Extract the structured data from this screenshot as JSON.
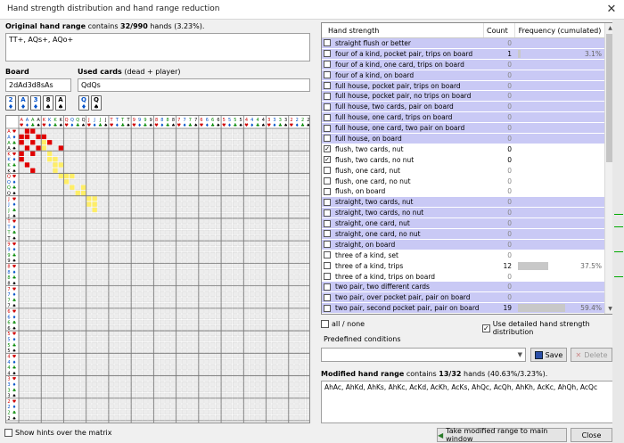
{
  "window": {
    "title": "Hand strength distribution and hand range reduction",
    "close_glyph": "✕"
  },
  "original_range": {
    "label": "Original hand range",
    "summary_prefix": "contains",
    "summary_count": "32/990",
    "summary_suffix": "hands (3.23%).",
    "value": "TT+, AQs+, AQo+"
  },
  "board": {
    "label": "Board",
    "value": "2dAd3d8sAs",
    "cards": [
      {
        "rank": "2",
        "suit": "♦",
        "color": "blu"
      },
      {
        "rank": "A",
        "suit": "♦",
        "color": "blu"
      },
      {
        "rank": "3",
        "suit": "♦",
        "color": "blu"
      },
      {
        "rank": "8",
        "suit": "♠",
        "color": "blk"
      },
      {
        "rank": "A",
        "suit": "♠",
        "color": "blk"
      }
    ]
  },
  "used_cards": {
    "label": "Used cards",
    "sublabel": "(dead + player)",
    "value": "QdQs",
    "cards": [
      {
        "rank": "Q",
        "suit": "♦",
        "color": "blu"
      },
      {
        "rank": "Q",
        "suit": "♠",
        "color": "blk"
      }
    ]
  },
  "matrix": {
    "ranks": [
      "A",
      "K",
      "Q",
      "J",
      "T",
      "9",
      "8",
      "7",
      "6",
      "5",
      "4",
      "3",
      "2"
    ],
    "suits": [
      {
        "glyph": "♥",
        "color": "#d00000"
      },
      {
        "glyph": "♦",
        "color": "#0050c8"
      },
      {
        "glyph": "♣",
        "color": "#008800"
      },
      {
        "glyph": "♠",
        "color": "#000000"
      }
    ],
    "red_cells": [
      [
        0,
        1
      ],
      [
        1,
        0
      ],
      [
        1,
        1
      ],
      [
        0,
        2
      ],
      [
        1,
        3
      ],
      [
        2,
        0
      ],
      [
        2,
        2
      ],
      [
        3,
        3
      ],
      [
        4,
        0
      ],
      [
        3,
        1
      ],
      [
        1,
        4
      ],
      [
        5,
        0
      ],
      [
        4,
        2
      ],
      [
        2,
        5
      ],
      [
        6,
        1
      ],
      [
        7,
        2
      ],
      [
        3,
        7
      ]
    ],
    "yellow_cells": [
      [
        2,
        4
      ],
      [
        3,
        4
      ],
      [
        4,
        5
      ],
      [
        5,
        5
      ],
      [
        5,
        6
      ],
      [
        6,
        6
      ],
      [
        6,
        7
      ],
      [
        7,
        6
      ],
      [
        8,
        7
      ],
      [
        8,
        8
      ],
      [
        9,
        8
      ],
      [
        8,
        9
      ],
      [
        10,
        9
      ],
      [
        11,
        10
      ],
      [
        10,
        11
      ],
      [
        12,
        12
      ],
      [
        11,
        11
      ],
      [
        12,
        13
      ],
      [
        13,
        12
      ],
      [
        14,
        13
      ],
      [
        13,
        13
      ]
    ],
    "colors": {
      "red": "#e00000",
      "yellow": "#ffee66"
    }
  },
  "hints_label": "Show hints over the matrix",
  "table": {
    "headers": [
      "Hand strength",
      "Count",
      "Frequency (cumulated)"
    ],
    "rows": [
      {
        "name": "straight flush or better",
        "count": "0",
        "checked": false,
        "hl": true,
        "freq": "",
        "pct": 0
      },
      {
        "name": "four of a kind, pocket pair, trips on board",
        "count": "1",
        "checked": false,
        "hl": true,
        "freq": "3.1%",
        "pct": 3.1
      },
      {
        "name": "four of a kind, one card, trips on board",
        "count": "0",
        "checked": false,
        "hl": true,
        "freq": "",
        "pct": 0
      },
      {
        "name": "four of a kind, on board",
        "count": "0",
        "checked": false,
        "hl": true,
        "freq": "",
        "pct": 0
      },
      {
        "name": "full house, pocket pair, trips on board",
        "count": "0",
        "checked": false,
        "hl": true,
        "freq": "",
        "pct": 0
      },
      {
        "name": "full house, pocket pair, no trips on board",
        "count": "0",
        "checked": false,
        "hl": true,
        "freq": "",
        "pct": 0
      },
      {
        "name": "full house, two cards, pair on board",
        "count": "0",
        "checked": false,
        "hl": true,
        "freq": "",
        "pct": 0
      },
      {
        "name": "full house, one card, trips on board",
        "count": "0",
        "checked": false,
        "hl": true,
        "freq": "",
        "pct": 0
      },
      {
        "name": "full house, one card, two pair on board",
        "count": "0",
        "checked": false,
        "hl": true,
        "freq": "",
        "pct": 0
      },
      {
        "name": "full house, on board",
        "count": "0",
        "checked": false,
        "hl": true,
        "freq": "",
        "pct": 0
      },
      {
        "name": "flush, two cards, nut",
        "count": "0",
        "checked": true,
        "hl": false,
        "freq": "",
        "pct": 0
      },
      {
        "name": "flush, two cards, no nut",
        "count": "0",
        "checked": true,
        "hl": false,
        "freq": "",
        "pct": 0
      },
      {
        "name": "flush, one card, nut",
        "count": "0",
        "checked": false,
        "hl": false,
        "freq": "",
        "pct": 0
      },
      {
        "name": "flush, one card, no nut",
        "count": "0",
        "checked": false,
        "hl": false,
        "freq": "",
        "pct": 0
      },
      {
        "name": "flush, on board",
        "count": "0",
        "checked": false,
        "hl": false,
        "freq": "",
        "pct": 0
      },
      {
        "name": "straight, two cards, nut",
        "count": "0",
        "checked": false,
        "hl": true,
        "freq": "",
        "pct": 0
      },
      {
        "name": "straight, two cards, no nut",
        "count": "0",
        "checked": false,
        "hl": true,
        "freq": "",
        "pct": 0
      },
      {
        "name": "straight, one card, nut",
        "count": "0",
        "checked": false,
        "hl": true,
        "freq": "",
        "pct": 0
      },
      {
        "name": "straight, one card, no nut",
        "count": "0",
        "checked": false,
        "hl": true,
        "freq": "",
        "pct": 0
      },
      {
        "name": "straight, on board",
        "count": "0",
        "checked": false,
        "hl": true,
        "freq": "",
        "pct": 0
      },
      {
        "name": "three of a kind, set",
        "count": "0",
        "checked": false,
        "hl": false,
        "freq": "",
        "pct": 0
      },
      {
        "name": "three of a kind, trips",
        "count": "12",
        "checked": false,
        "hl": false,
        "freq": "37.5%",
        "pct": 37.5
      },
      {
        "name": "three of a kind, trips on board",
        "count": "0",
        "checked": false,
        "hl": false,
        "freq": "",
        "pct": 0
      },
      {
        "name": "two pair, two different cards",
        "count": "0",
        "checked": false,
        "hl": true,
        "freq": "",
        "pct": 0
      },
      {
        "name": "two pair, over pocket pair, pair on board",
        "count": "0",
        "checked": false,
        "hl": true,
        "freq": "",
        "pct": 0
      },
      {
        "name": "two pair, second pocket pair, pair on board",
        "count": "19",
        "checked": false,
        "hl": true,
        "freq": "59.4%",
        "pct": 59.4
      }
    ]
  },
  "all_none_label": "all / none",
  "detailed_label": "Use detailed hand strength distribution",
  "predefined_label": "Predefined conditions",
  "save_label": "Save",
  "delete_label": "Delete",
  "modified_range": {
    "label": "Modified hand range",
    "summary_prefix": "contains",
    "summary_count": "13/32",
    "summary_suffix": "hands (40.63%/3.23%).",
    "value": "AhAc, AhKd, AhKs, AhKc, AcKd, AcKh, AcKs, AhQc, AcQh, AhKh, AcKc, AhQh, AcQc"
  },
  "take_label": "Take modified range to main window",
  "close_label": "Close"
}
